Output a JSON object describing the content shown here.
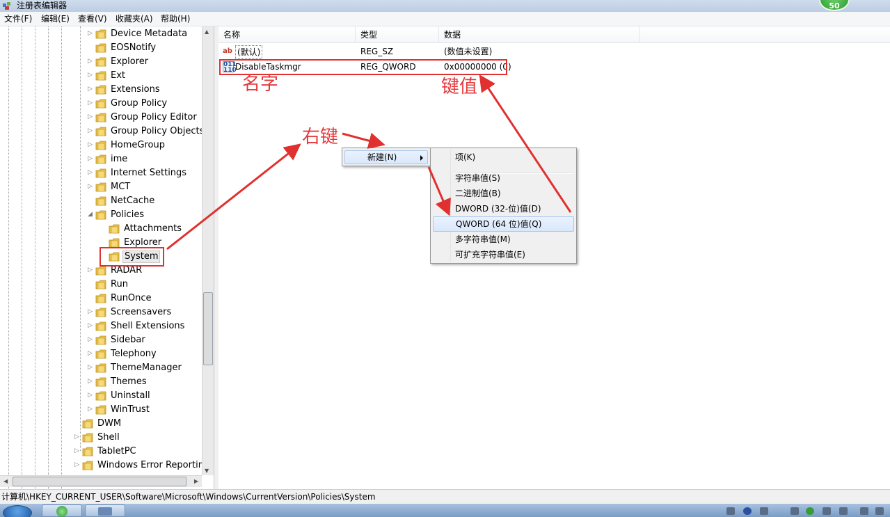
{
  "window": {
    "title": "注册表编辑器",
    "badge": "50"
  },
  "menu": [
    "文件(F)",
    "编辑(E)",
    "查看(V)",
    "收藏夹(A)",
    "帮助(H)"
  ],
  "tree": {
    "items": [
      {
        "label": "Device Metadata",
        "level": 2,
        "expander": "collapsed"
      },
      {
        "label": "EOSNotify",
        "level": 2,
        "expander": "none"
      },
      {
        "label": "Explorer",
        "level": 2,
        "expander": "collapsed"
      },
      {
        "label": "Ext",
        "level": 2,
        "expander": "collapsed"
      },
      {
        "label": "Extensions",
        "level": 2,
        "expander": "collapsed"
      },
      {
        "label": "Group Policy",
        "level": 2,
        "expander": "collapsed"
      },
      {
        "label": "Group Policy Editor",
        "level": 2,
        "expander": "collapsed"
      },
      {
        "label": "Group Policy Objects",
        "level": 2,
        "expander": "collapsed"
      },
      {
        "label": "HomeGroup",
        "level": 2,
        "expander": "collapsed"
      },
      {
        "label": "ime",
        "level": 2,
        "expander": "collapsed"
      },
      {
        "label": "Internet Settings",
        "level": 2,
        "expander": "collapsed"
      },
      {
        "label": "MCT",
        "level": 2,
        "expander": "collapsed"
      },
      {
        "label": "NetCache",
        "level": 2,
        "expander": "none"
      },
      {
        "label": "Policies",
        "level": 2,
        "expander": "expanded"
      },
      {
        "label": "Attachments",
        "level": 3,
        "expander": "none"
      },
      {
        "label": "Explorer",
        "level": 3,
        "expander": "none"
      },
      {
        "label": "System",
        "level": 3,
        "expander": "none",
        "selected": true
      },
      {
        "label": "RADAR",
        "level": 2,
        "expander": "collapsed"
      },
      {
        "label": "Run",
        "level": 2,
        "expander": "none"
      },
      {
        "label": "RunOnce",
        "level": 2,
        "expander": "none"
      },
      {
        "label": "Screensavers",
        "level": 2,
        "expander": "collapsed"
      },
      {
        "label": "Shell Extensions",
        "level": 2,
        "expander": "collapsed"
      },
      {
        "label": "Sidebar",
        "level": 2,
        "expander": "collapsed"
      },
      {
        "label": "Telephony",
        "level": 2,
        "expander": "collapsed"
      },
      {
        "label": "ThemeManager",
        "level": 2,
        "expander": "collapsed"
      },
      {
        "label": "Themes",
        "level": 2,
        "expander": "collapsed"
      },
      {
        "label": "Uninstall",
        "level": 2,
        "expander": "collapsed"
      },
      {
        "label": "WinTrust",
        "level": 2,
        "expander": "collapsed"
      },
      {
        "label": "DWM",
        "level": 1,
        "expander": "none"
      },
      {
        "label": "Shell",
        "level": 1,
        "expander": "collapsed"
      },
      {
        "label": "TabletPC",
        "level": 1,
        "expander": "collapsed"
      },
      {
        "label": "Windows Error Reporting",
        "level": 1,
        "expander": "collapsed"
      }
    ]
  },
  "list": {
    "columns": [
      "名称",
      "类型",
      "数据"
    ],
    "rows": [
      {
        "icon": "string-value-icon",
        "icon_text": "ab",
        "name": "(默认)",
        "type": "REG_SZ",
        "data": "(数值未设置)"
      },
      {
        "icon": "binary-value-icon",
        "icon_text": "011\n110",
        "name": "DisableTaskmgr",
        "type": "REG_QWORD",
        "data": "0x00000000 (0)"
      }
    ]
  },
  "context_menu": {
    "parent": "新建(N)",
    "items": [
      "项(K)",
      "字符串值(S)",
      "二进制值(B)",
      "DWORD (32-位)值(D)",
      "QWORD (64 位)值(Q)",
      "多字符串值(M)",
      "可扩充字符串值(E)"
    ],
    "highlighted": "QWORD (64 位)值(Q)"
  },
  "annotations": {
    "name_label": "名字",
    "value_label": "键值",
    "right_click_label": "右键",
    "color": "#e0302f"
  },
  "statusbar": {
    "path": "计算机\\HKEY_CURRENT_USER\\Software\\Microsoft\\Windows\\CurrentVersion\\Policies\\System"
  }
}
